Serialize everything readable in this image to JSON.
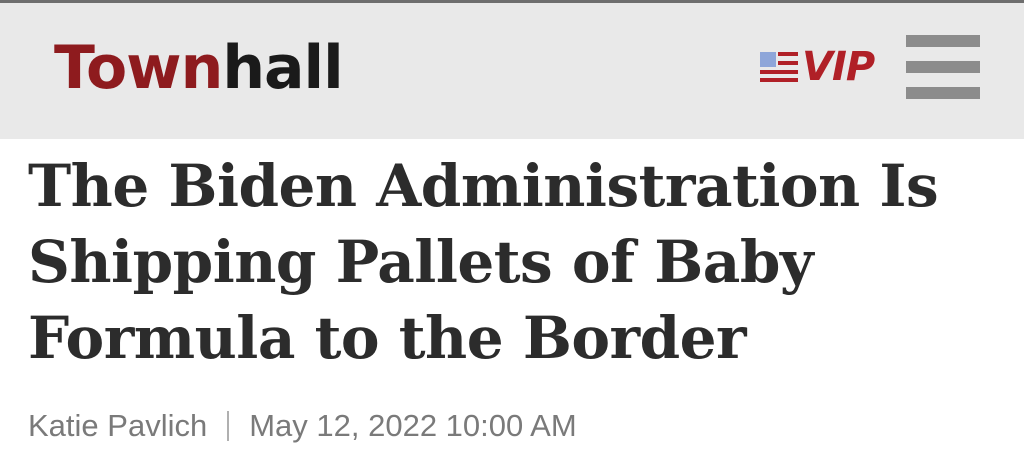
{
  "header": {
    "logo": {
      "part1": "Town",
      "part2": "hall"
    },
    "vip_label": "VIP",
    "menu_icon": "hamburger-menu-icon"
  },
  "article": {
    "title": "The Biden Administration Is Shipping Pallets of Baby Formula to the Border",
    "author": "Katie Pavlich",
    "date": "May 12, 2022 10:00 AM"
  },
  "colors": {
    "brand_red": "#8e1b1e",
    "vip_red": "#b02027",
    "header_bg": "#e9e9e9",
    "headline": "#2c2c2c",
    "byline": "#7a7a7a"
  }
}
